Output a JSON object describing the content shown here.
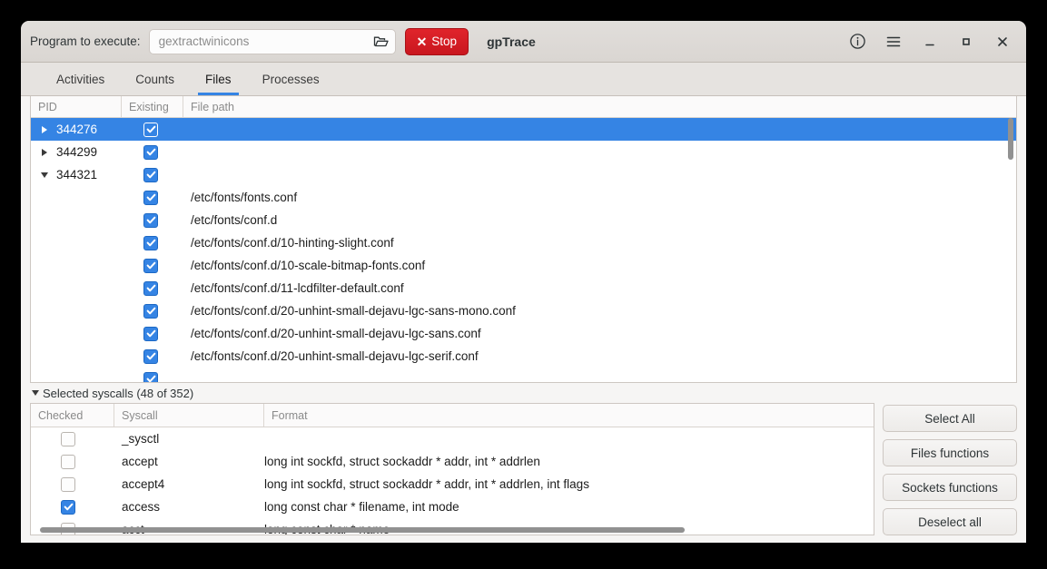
{
  "window": {
    "title": "gpTrace"
  },
  "headerbar": {
    "program_label": "Program to execute:",
    "program_value": "gextractwinicons",
    "program_placeholder": "gextractwinicons",
    "browse_icon": "folder-open-icon",
    "stop_label": "Stop",
    "stop_icon": "close-x-icon",
    "stop_color": "#cf1d24",
    "about_icon": "info-icon",
    "menu_icon": "hamburger-menu-icon",
    "minimize_icon": "minimize-icon",
    "maximize_icon": "maximize-icon",
    "close_icon": "window-close-icon"
  },
  "tabs": [
    {
      "label": "Activities",
      "active": false
    },
    {
      "label": "Counts",
      "active": false
    },
    {
      "label": "Files",
      "active": true
    },
    {
      "label": "Processes",
      "active": false
    }
  ],
  "accent_color": "#3584e4",
  "files_tree": {
    "columns": [
      "PID",
      "Existing",
      "File path"
    ],
    "rows": [
      {
        "pid": "344276",
        "expander": "collapsed",
        "existing": true,
        "path": "",
        "selected": true,
        "child": false
      },
      {
        "pid": "344299",
        "expander": "collapsed",
        "existing": true,
        "path": "",
        "selected": false,
        "child": false
      },
      {
        "pid": "344321",
        "expander": "expanded",
        "existing": true,
        "path": "",
        "selected": false,
        "child": false
      },
      {
        "pid": "",
        "expander": "none",
        "existing": true,
        "path": "/etc/fonts/fonts.conf",
        "selected": false,
        "child": true
      },
      {
        "pid": "",
        "expander": "none",
        "existing": true,
        "path": "/etc/fonts/conf.d",
        "selected": false,
        "child": true
      },
      {
        "pid": "",
        "expander": "none",
        "existing": true,
        "path": "/etc/fonts/conf.d/10-hinting-slight.conf",
        "selected": false,
        "child": true
      },
      {
        "pid": "",
        "expander": "none",
        "existing": true,
        "path": "/etc/fonts/conf.d/10-scale-bitmap-fonts.conf",
        "selected": false,
        "child": true
      },
      {
        "pid": "",
        "expander": "none",
        "existing": true,
        "path": "/etc/fonts/conf.d/11-lcdfilter-default.conf",
        "selected": false,
        "child": true
      },
      {
        "pid": "",
        "expander": "none",
        "existing": true,
        "path": "/etc/fonts/conf.d/20-unhint-small-dejavu-lgc-sans-mono.conf",
        "selected": false,
        "child": true
      },
      {
        "pid": "",
        "expander": "none",
        "existing": true,
        "path": "/etc/fonts/conf.d/20-unhint-small-dejavu-lgc-sans.conf",
        "selected": false,
        "child": true
      },
      {
        "pid": "",
        "expander": "none",
        "existing": true,
        "path": "/etc/fonts/conf.d/20-unhint-small-dejavu-lgc-serif.conf",
        "selected": false,
        "child": true
      },
      {
        "pid": "",
        "expander": "none",
        "existing": true,
        "path": "",
        "selected": false,
        "child": true
      }
    ]
  },
  "syscalls_panel": {
    "header": "Selected syscalls (48 of 352)",
    "selected_count": 48,
    "total_count": 352,
    "columns": [
      "Checked",
      "Syscall",
      "Format"
    ],
    "rows": [
      {
        "checked": false,
        "syscall": "_sysctl",
        "format": ""
      },
      {
        "checked": false,
        "syscall": "accept",
        "format": "long int sockfd, struct sockaddr * addr, int * addrlen"
      },
      {
        "checked": false,
        "syscall": "accept4",
        "format": "long int sockfd, struct sockaddr * addr, int * addrlen, int flags"
      },
      {
        "checked": true,
        "syscall": "access",
        "format": "long const char * filename, int mode"
      },
      {
        "checked": false,
        "syscall": "acct",
        "format": "long const char * name"
      }
    ],
    "buttons": [
      {
        "label": "Select All"
      },
      {
        "label": "Files functions"
      },
      {
        "label": "Sockets functions"
      },
      {
        "label": "Deselect all"
      }
    ]
  }
}
